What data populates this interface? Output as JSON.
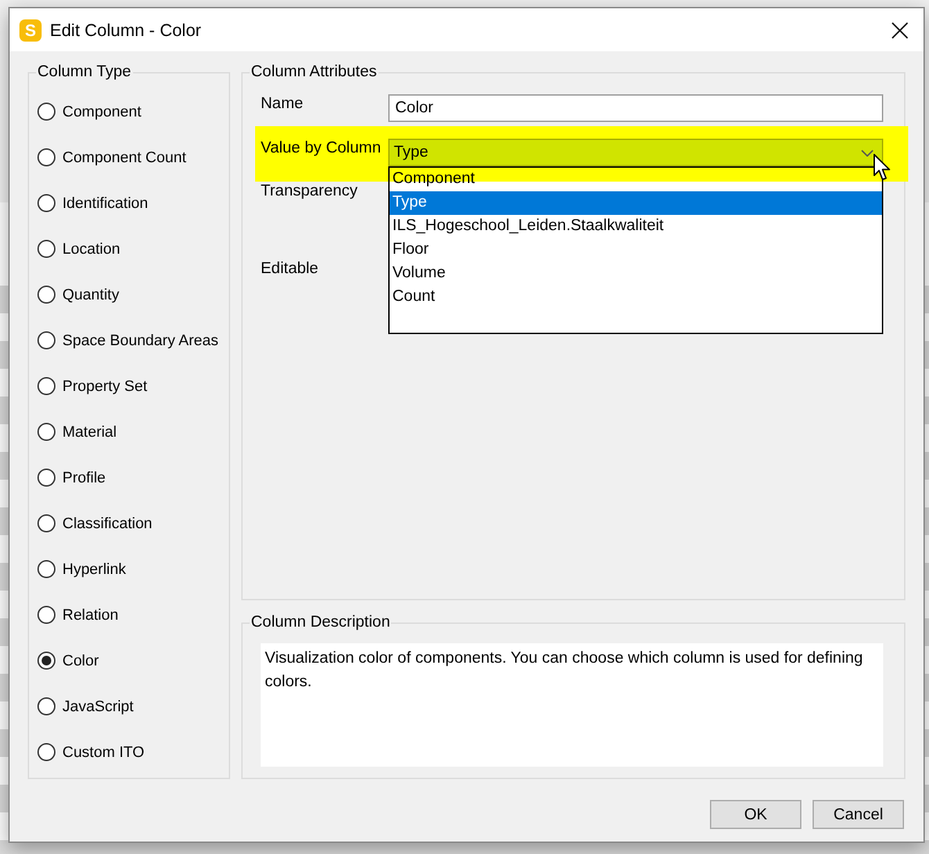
{
  "window": {
    "title": "Edit Column - Color",
    "icon_letter": "S"
  },
  "column_type": {
    "legend": "Column Type",
    "options": [
      {
        "label": "Component",
        "selected": false
      },
      {
        "label": "Component Count",
        "selected": false
      },
      {
        "label": "Identification",
        "selected": false
      },
      {
        "label": "Location",
        "selected": false
      },
      {
        "label": "Quantity",
        "selected": false
      },
      {
        "label": "Space Boundary Areas",
        "selected": false
      },
      {
        "label": "Property Set",
        "selected": false
      },
      {
        "label": "Material",
        "selected": false
      },
      {
        "label": "Profile",
        "selected": false
      },
      {
        "label": "Classification",
        "selected": false
      },
      {
        "label": "Hyperlink",
        "selected": false
      },
      {
        "label": "Relation",
        "selected": false
      },
      {
        "label": "Color",
        "selected": true
      },
      {
        "label": "JavaScript",
        "selected": false
      },
      {
        "label": "Custom ITO",
        "selected": false
      }
    ]
  },
  "column_attributes": {
    "legend": "Column Attributes",
    "fields": [
      {
        "kind": "text",
        "label": "Name",
        "value": "Color"
      },
      {
        "kind": "dropdown",
        "label": "Value by Column",
        "value": "Type",
        "highlighted": true,
        "expanded": true,
        "options": [
          {
            "label": "Component",
            "selected": false
          },
          {
            "label": "Type",
            "selected": true
          },
          {
            "label": "ILS_Hogeschool_Leiden.Staalkwaliteit",
            "selected": false
          },
          {
            "label": "Floor",
            "selected": false
          },
          {
            "label": "Volume",
            "selected": false
          },
          {
            "label": "Count",
            "selected": false
          }
        ]
      },
      {
        "kind": "covered",
        "label": "Transparency"
      },
      {
        "kind": "covered",
        "label": "Editable"
      }
    ]
  },
  "column_description": {
    "legend": "Column Description",
    "text": "Visualization color of components. You can choose which column is used for defining colors."
  },
  "buttons": [
    {
      "label": "OK"
    },
    {
      "label": "Cancel"
    }
  ]
}
